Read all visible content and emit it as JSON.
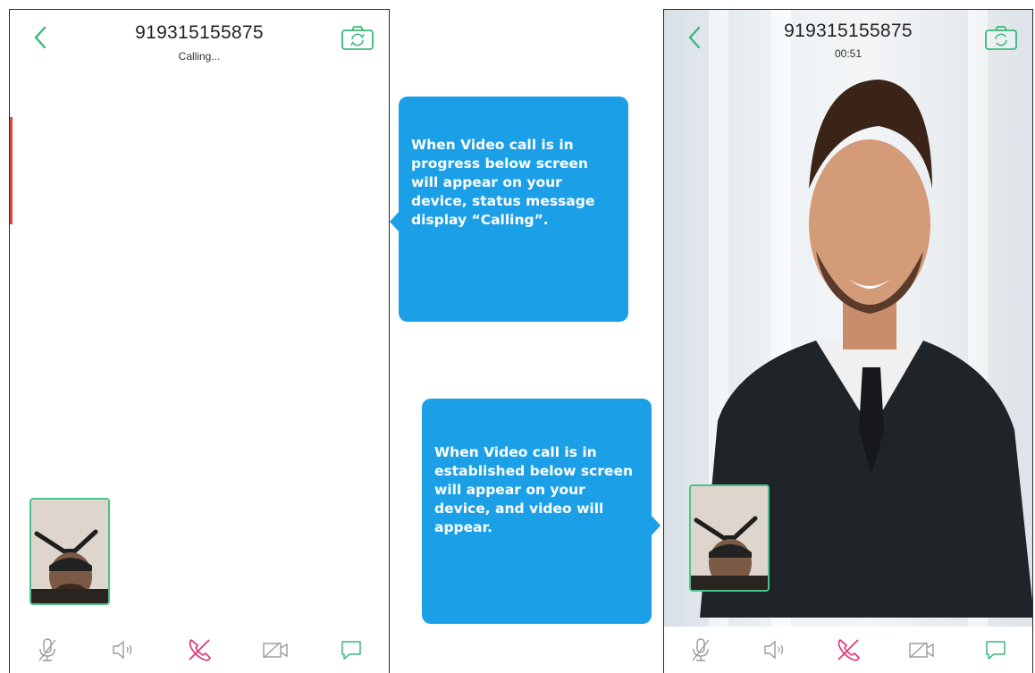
{
  "left_screen": {
    "number": "919315155875",
    "status": "Calling...",
    "icons": {
      "back": "chevron-left-icon",
      "camera_switch": "camera-switch-icon",
      "controls": [
        "mic-mute-icon",
        "speaker-icon",
        "end-call-icon",
        "video-off-icon",
        "chat-icon"
      ]
    }
  },
  "right_screen": {
    "number": "919315155875",
    "timer": "00:51"
  },
  "callouts": {
    "progress": "When Video call is in progress below screen will appear on your device, status message display “Calling”.",
    "established": "When Video call is in established below screen will appear on your device, and video will appear."
  },
  "colors": {
    "accent_green": "#3cb878",
    "end_call_pink": "#e0306f",
    "icon_gray": "#9a9a9a",
    "callout_blue": "#1ba0e8"
  }
}
